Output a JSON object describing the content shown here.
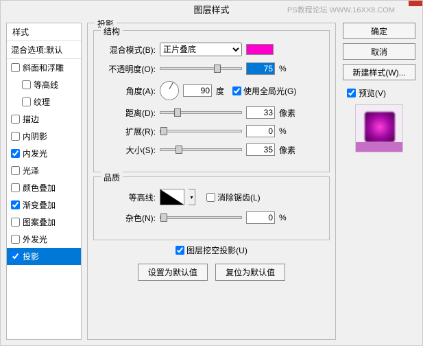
{
  "watermark": "PS教程论坛 WWW.16XX8.COM",
  "title": "图层样式",
  "left": {
    "header": "样式",
    "blend_default": "混合选项:默认",
    "styles": [
      {
        "label": "斜面和浮雕",
        "checked": false,
        "indent": false
      },
      {
        "label": "等高线",
        "checked": false,
        "indent": true
      },
      {
        "label": "纹理",
        "checked": false,
        "indent": true
      },
      {
        "label": "描边",
        "checked": false,
        "indent": false
      },
      {
        "label": "内阴影",
        "checked": false,
        "indent": false
      },
      {
        "label": "内发光",
        "checked": true,
        "indent": false
      },
      {
        "label": "光泽",
        "checked": false,
        "indent": false
      },
      {
        "label": "颜色叠加",
        "checked": false,
        "indent": false
      },
      {
        "label": "渐变叠加",
        "checked": true,
        "indent": false
      },
      {
        "label": "图案叠加",
        "checked": false,
        "indent": false
      },
      {
        "label": "外发光",
        "checked": false,
        "indent": false
      },
      {
        "label": "投影",
        "checked": true,
        "indent": false,
        "selected": true
      }
    ]
  },
  "center": {
    "panel_title": "投影",
    "structure": {
      "title": "结构",
      "blend_mode_label": "混合模式(B):",
      "blend_mode_value": "正片叠底",
      "opacity_label": "不透明度(O):",
      "opacity_value": "75",
      "opacity_unit": "%",
      "angle_label": "角度(A):",
      "angle_value": "90",
      "angle_unit": "度",
      "global_light": "使用全局光(G)",
      "distance_label": "距离(D):",
      "distance_value": "33",
      "distance_unit": "像素",
      "spread_label": "扩展(R):",
      "spread_value": "0",
      "spread_unit": "%",
      "size_label": "大小(S):",
      "size_value": "35",
      "size_unit": "像素"
    },
    "quality": {
      "title": "品质",
      "contour_label": "等高线:",
      "antialias": "消除锯齿(L)",
      "noise_label": "杂色(N):",
      "noise_value": "0",
      "noise_unit": "%"
    },
    "knockout": "图层挖空投影(U)",
    "set_default": "设置为默认值",
    "reset_default": "复位为默认值"
  },
  "right": {
    "ok": "确定",
    "cancel": "取消",
    "new_style": "新建样式(W)...",
    "preview": "预览(V)"
  }
}
